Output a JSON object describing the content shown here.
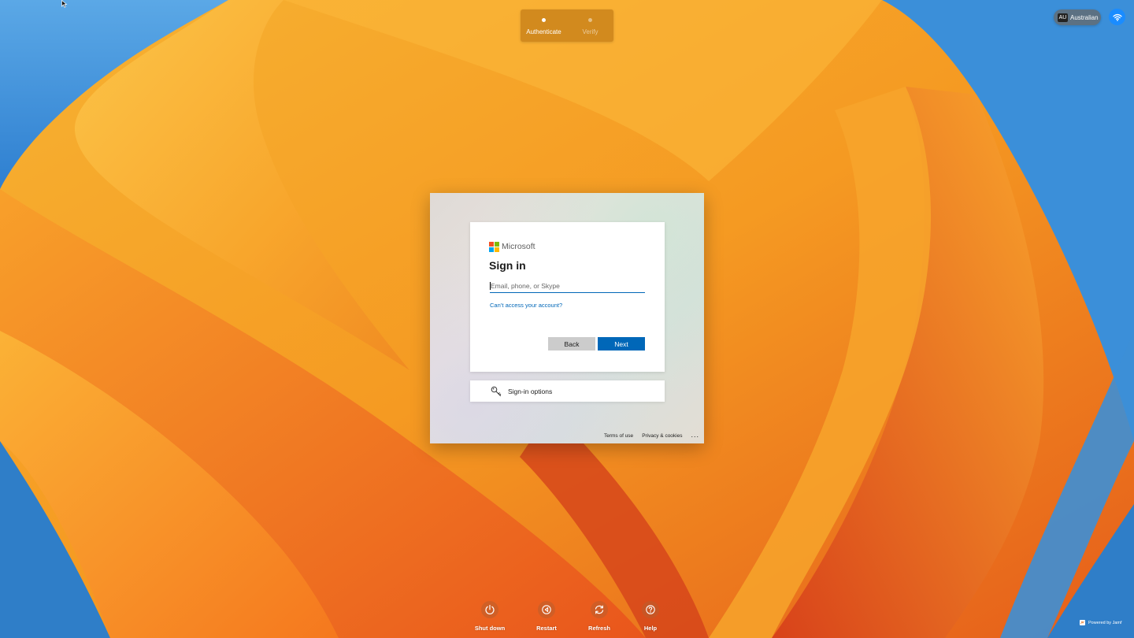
{
  "progress": {
    "steps": [
      {
        "label": "Authenticate",
        "state": "active"
      },
      {
        "label": "Verify",
        "state": "inactive"
      }
    ]
  },
  "topbar": {
    "language_code": "AU",
    "language_name": "Australian",
    "wifi_icon": "wifi-icon"
  },
  "login": {
    "brand": "Microsoft",
    "title": "Sign in",
    "email_placeholder": "Email, phone, or Skype",
    "email_value": "",
    "cant_access": "Can’t access your account?",
    "back_label": "Back",
    "next_label": "Next",
    "signin_options": "Sign-in options",
    "footer": {
      "terms": "Terms of use",
      "privacy": "Privacy & cookies",
      "more": "..."
    }
  },
  "bottom_actions": [
    {
      "label": "Shut down",
      "icon": "power-icon"
    },
    {
      "label": "Restart",
      "icon": "restart-icon"
    },
    {
      "label": "Refresh",
      "icon": "refresh-icon"
    },
    {
      "label": "Help",
      "icon": "help-icon"
    }
  ],
  "powered_by": "Powered by Jamf",
  "colors": {
    "ms_blue": "#0067b8",
    "ms_red": "#f25022",
    "ms_green": "#7fba00",
    "ms_blue_square": "#00a4ef",
    "ms_yellow": "#ffb900",
    "wifi_blue": "#1a8cff"
  }
}
